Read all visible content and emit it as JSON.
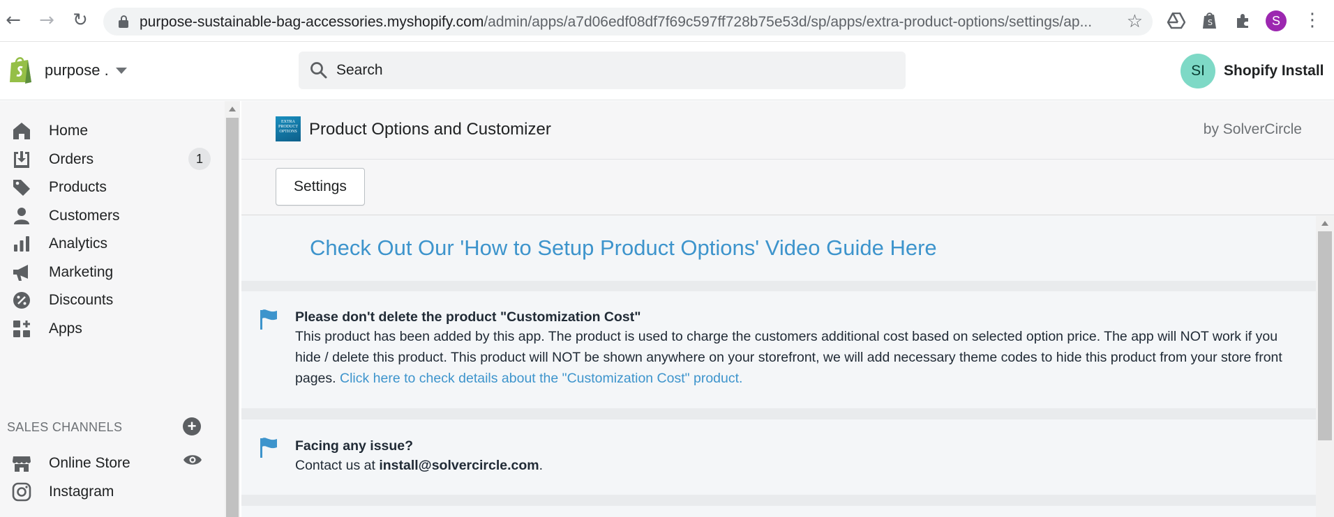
{
  "browser": {
    "url_host": "purpose-sustainable-bag-accessories.myshopify.com",
    "url_path": "/admin/apps/a7d06edf08df7f69c597ff728b75e53d/sp/apps/extra-product-options/settings/ap...",
    "profile_initial": "S",
    "profile_color": "#9c27b0"
  },
  "topbar": {
    "store_name": "purpose .",
    "search_placeholder": "Search",
    "user_initials": "SI",
    "user_name": "Shopify Install",
    "avatar_color": "#7ed9c6"
  },
  "sidebar": {
    "items": [
      {
        "label": "Home",
        "icon": "home-icon"
      },
      {
        "label": "Orders",
        "icon": "orders-icon",
        "badge": "1"
      },
      {
        "label": "Products",
        "icon": "tag-icon"
      },
      {
        "label": "Customers",
        "icon": "person-icon"
      },
      {
        "label": "Analytics",
        "icon": "bar-chart-icon"
      },
      {
        "label": "Marketing",
        "icon": "megaphone-icon"
      },
      {
        "label": "Discounts",
        "icon": "discount-icon"
      },
      {
        "label": "Apps",
        "icon": "apps-icon"
      }
    ],
    "sales_channels_heading": "SALES CHANNELS",
    "channels": [
      {
        "label": "Online Store",
        "icon": "store-icon"
      },
      {
        "label": "Instagram",
        "icon": "instagram-icon"
      }
    ]
  },
  "app": {
    "logo_text": "EXTRA PRODUCT OPTIONS",
    "title": "Product Options and Customizer",
    "by": "by SolverCircle",
    "settings_label": "Settings",
    "guide_link": "Check Out Our 'How to Setup Product Options' Video Guide Here",
    "notices": [
      {
        "title": "Please don't delete the product \"Customization Cost\"",
        "body": "This product has been added by this app. The product is used to charge the customers additional cost based on selected option price. The app will NOT work if you hide / delete this product. This product will NOT be shown anywhere on your storefront, we will add necessary theme codes to hide this product from your store front pages.",
        "link": "Click here to check details about the \"Customization Cost\" product."
      },
      {
        "title": "Facing any issue?",
        "body_prefix": "Contact us at",
        "email": "install@solvercircle.com",
        "body_suffix": "."
      }
    ],
    "link_color": "#3d94cc",
    "flag_color": "#3d94cc"
  }
}
